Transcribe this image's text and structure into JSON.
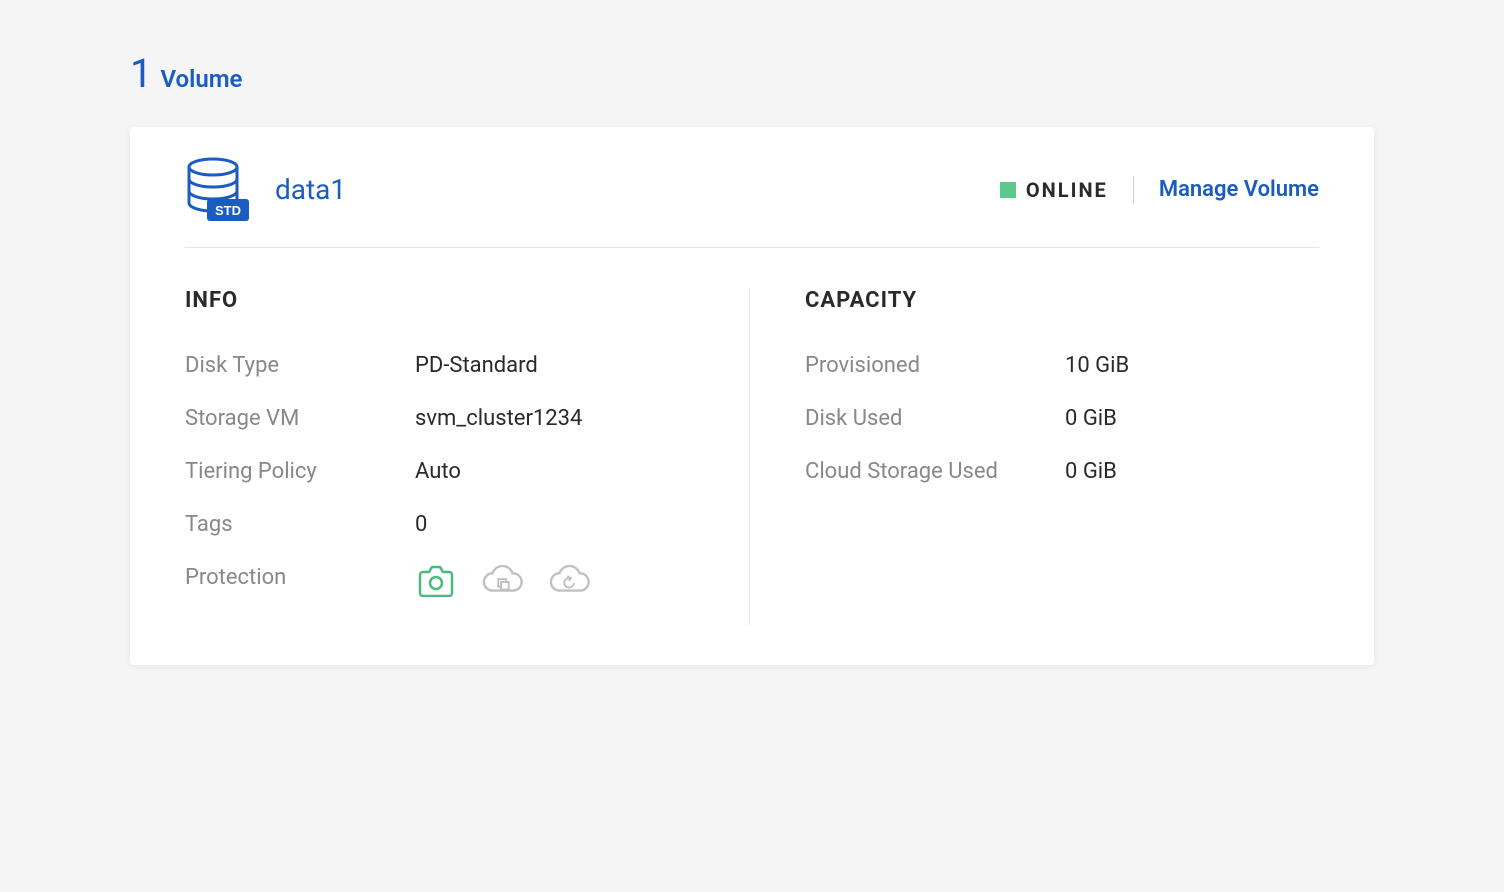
{
  "header": {
    "count": "1",
    "label": "Volume"
  },
  "volume": {
    "name": "data1",
    "badge": "STD",
    "status": "ONLINE",
    "manage_label": "Manage Volume"
  },
  "info": {
    "title": "INFO",
    "disk_type_label": "Disk Type",
    "disk_type_value": "PD-Standard",
    "storage_vm_label": "Storage VM",
    "storage_vm_value": "svm_cluster1234",
    "tiering_label": "Tiering Policy",
    "tiering_value": "Auto",
    "tags_label": "Tags",
    "tags_value": "0",
    "protection_label": "Protection"
  },
  "capacity": {
    "title": "CAPACITY",
    "provisioned_label": "Provisioned",
    "provisioned_value": "10 GiB",
    "disk_used_label": "Disk Used",
    "disk_used_value": "0 GiB",
    "cloud_used_label": "Cloud Storage Used",
    "cloud_used_value": "0 GiB"
  }
}
